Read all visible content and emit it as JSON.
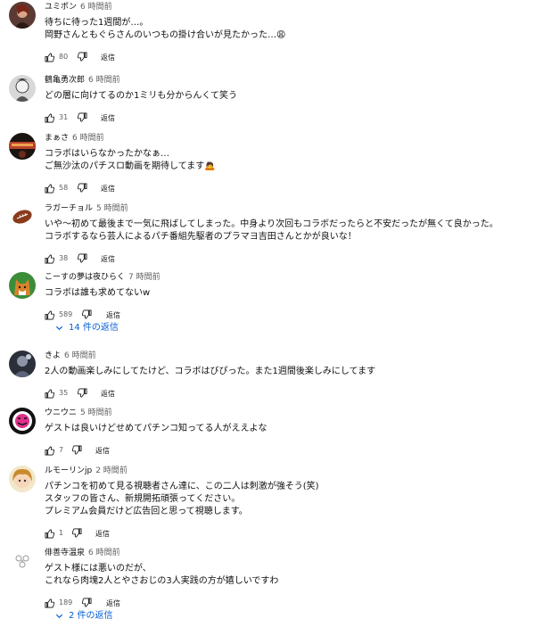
{
  "comments": [
    {
      "author": "ユミポン",
      "time": "6 時間前",
      "lines": [
        "待ちに待った1週間が…。",
        "岡野さんともぐらさんのいつもの掛け合いが見たかった…😩"
      ],
      "likes": "80",
      "reply_label": "返信"
    },
    {
      "author": "鶴亀勇次郎",
      "time": "6 時間前",
      "lines": [
        "どの層に向けてるのか1ミリも分からんくて笑う"
      ],
      "likes": "31",
      "reply_label": "返信"
    },
    {
      "author": "まぁさ",
      "time": "6 時間前",
      "lines": [
        "コラボはいらなかったかなぁ…",
        "ご無沙汰のパチスロ動画を期待してます🙇"
      ],
      "likes": "58",
      "reply_label": "返信"
    },
    {
      "author": "ラガーチョル",
      "time": "5 時間前",
      "lines": [
        "いや〜初めて最後まで一気に飛ばしてしまった。中身より次回もコラボだったらと不安だったが無くて良かった。",
        "コラボするなら芸人によるパチ番組先駆者のプラマヨ吉田さんとかが良いな！"
      ],
      "likes": "38",
      "reply_label": "返信"
    },
    {
      "author": "こーすの夢は夜ひらく",
      "time": "7 時間前",
      "lines": [
        "コラボは誰も求めてないw"
      ],
      "likes": "589",
      "reply_label": "返信",
      "replies": "14 件の返信"
    },
    {
      "author": "きよ",
      "time": "6 時間前",
      "lines": [
        "2人の動画楽しみにしてたけど、コラボはびぴった。また1週間後楽しみにしてます"
      ],
      "likes": "35",
      "reply_label": "返信"
    },
    {
      "author": "ウニウニ",
      "time": "5 時間前",
      "lines": [
        "ゲストは良いけどせめてパチンコ知ってる人がええよな"
      ],
      "likes": "7",
      "reply_label": "返信"
    },
    {
      "author": "ルモーリンjp",
      "time": "2 時間前",
      "lines": [
        "パチンコを初めて見る視聴者さん達に、この二人は刺激が強そう(笑)",
        "スタッフの皆さん、新規開拓頑張ってください。",
        "プレミアム会員だけど広告回と思って視聴します。"
      ],
      "likes": "1",
      "reply_label": "返信"
    },
    {
      "author": "俳善寺温泉",
      "time": "6 時間前",
      "lines": [
        "ゲスト様には悪いのだが、",
        "これなら肉塊2人とやさおじの3人実践の方が嬉しいですわ"
      ],
      "likes": "189",
      "reply_label": "返信",
      "replies": "2 件の返信"
    }
  ],
  "colors": {
    "link": "#065fd4",
    "secondary": "#606060"
  },
  "icons": {
    "like": "thumb-up-icon",
    "dislike": "thumb-down-icon",
    "expand": "chevron-down-icon"
  }
}
